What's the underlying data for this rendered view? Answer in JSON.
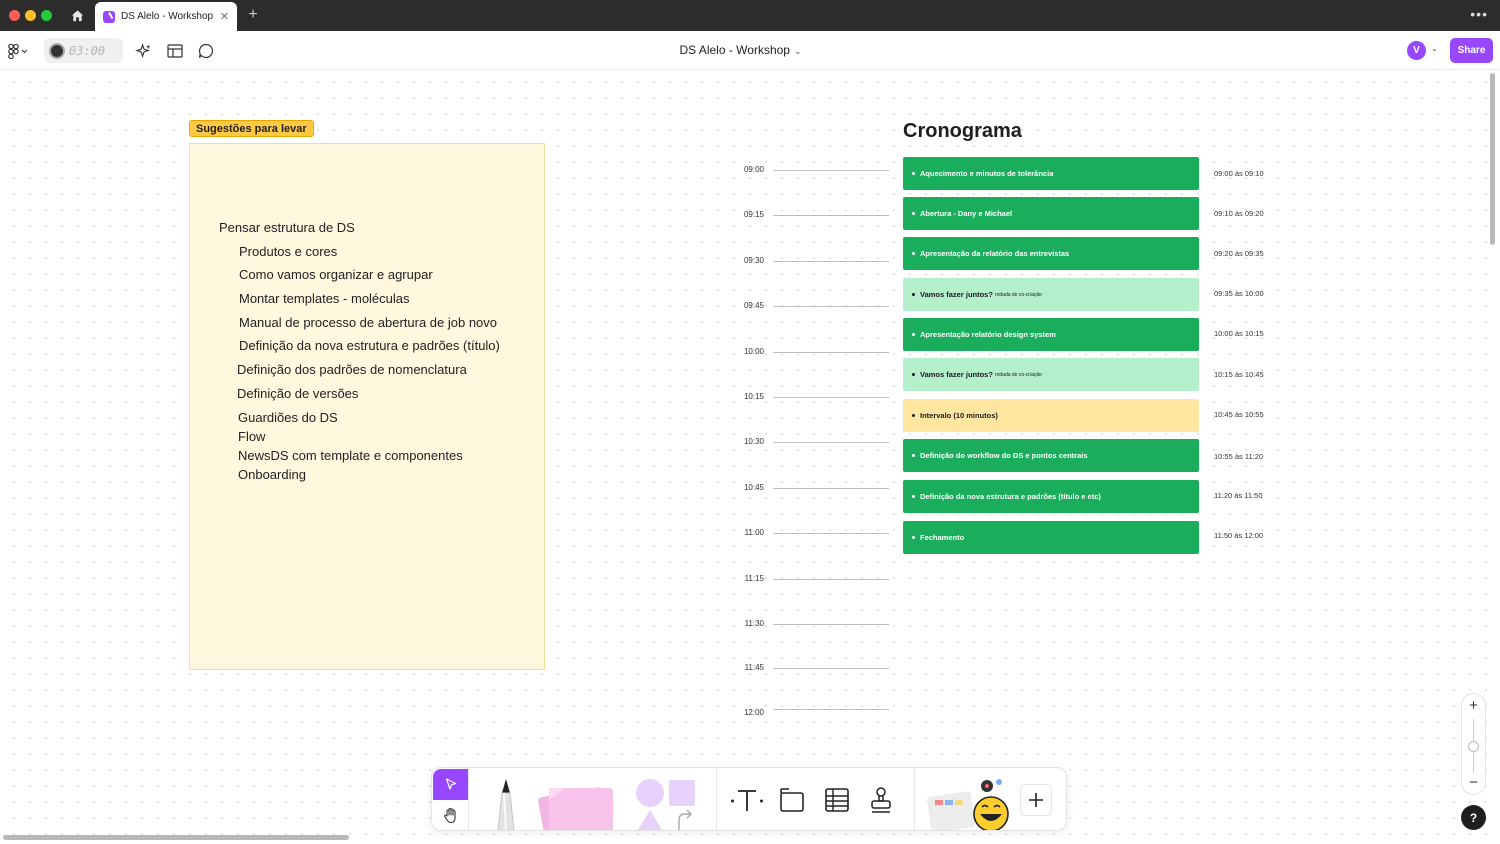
{
  "tab": {
    "title": "DS Alelo - Workshop"
  },
  "toolbar": {
    "file_title": "DS Alelo - Workshop",
    "timer": "03:00",
    "share_label": "Share",
    "avatar_initial": "V"
  },
  "note": {
    "sticker": "Sugestões para levar",
    "lines": [
      "Pensar estrutura de DS",
      "Produtos e cores",
      "Como vamos organizar e agrupar",
      "Montar templates - moléculas",
      "Manual de processo de abertura de job novo",
      "Definição da nova estrutura e padrões (título)",
      "Definição dos padrões de nomenclatura",
      "Definição de versões",
      "Guardiões do DS",
      "Flow",
      "NewsDS com template e componentes",
      "Onboarding"
    ]
  },
  "schedule": {
    "title": "Cronograma",
    "times": [
      "09:00",
      "09:15",
      "09:30",
      "09:45",
      "10:00",
      "10:15",
      "10:30",
      "10:45",
      "11:00",
      "11:15",
      "11:30",
      "11:45",
      "12:00"
    ],
    "blocks": [
      {
        "label": "Aquecimento e minutos de tolerância",
        "sub": "",
        "range": "09:00 às 09:10",
        "style": "green"
      },
      {
        "label": "Abertura - Dany e Michael",
        "sub": "",
        "range": "09:10 às 09:20",
        "style": "green"
      },
      {
        "label": "Apresentação da relatório das entrevistas",
        "sub": "",
        "range": "09:20 às 09:35",
        "style": "green"
      },
      {
        "label": "Vamos fazer juntos?",
        "sub": "rodada de co-criação",
        "range": "09:35 às 10:00",
        "style": "light"
      },
      {
        "label": "Apresentação relatório design system",
        "sub": "",
        "range": "10:00 às 10:15",
        "style": "green"
      },
      {
        "label": "Vamos fazer juntos?",
        "sub": "rodada de co-criação",
        "range": "10:15 às 10:45",
        "style": "light"
      },
      {
        "label": "Intervalo (10 minutos)",
        "sub": "",
        "range": "10:45 às 10:55",
        "style": "yellow"
      },
      {
        "label": "Definição do workflow do DS e pontos centrais",
        "sub": "",
        "range": "10:55 às 11:20",
        "style": "green"
      },
      {
        "label": "Definição da nova estrutura e padrões (título e etc)",
        "sub": "",
        "range": "11:20 às 11:50",
        "style": "green"
      },
      {
        "label": "Fechamento",
        "sub": "",
        "range": "11:50 às 12:00",
        "style": "green"
      }
    ]
  },
  "colors": {
    "accent": "#9747ff",
    "green": "#1aad5b",
    "light_green": "#b3f0cb",
    "yellow": "#ffe6a0",
    "sticky": "#fff7de"
  }
}
